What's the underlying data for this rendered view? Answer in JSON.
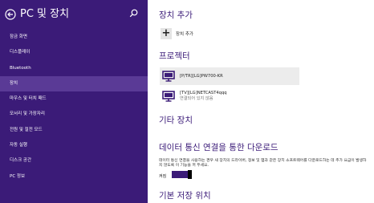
{
  "sidebar": {
    "title": "PC 및 장치",
    "items": [
      {
        "label": "잠금 화면",
        "active": false
      },
      {
        "label": "디스플레이",
        "active": false
      },
      {
        "label": "Bluetooth",
        "active": false
      },
      {
        "label": "장치",
        "active": true
      },
      {
        "label": "마우스 및 터치 패드",
        "active": false
      },
      {
        "label": "모서리 및 가장자리",
        "active": false
      },
      {
        "label": "전원 및 절전 모드",
        "active": false
      },
      {
        "label": "자동 실행",
        "active": false
      },
      {
        "label": "디스크 공간",
        "active": false
      },
      {
        "label": "PC 정보",
        "active": false
      }
    ]
  },
  "main": {
    "add_devices": {
      "heading": "장치 추가",
      "button_label": "장치 추가"
    },
    "projectors": {
      "heading": "프로젝터",
      "devices": [
        {
          "name": "[P/TR][LG]PW700-KR",
          "status": ""
        },
        {
          "name": "[TV][LG]NETCAST4qqq",
          "status": "연결되어 있지 않음"
        }
      ]
    },
    "other_devices": {
      "heading": "기타 장치"
    },
    "metered": {
      "heading": "데이터 통신 연결을 통한 다운로드",
      "description": "데이터 통신 연결을 사용하는 경우 새 장치의 드라이버, 정보 및 앱과 같은 장치 소프트웨어를 다운로드하는 데 추가 요금이 발생하지 않도록 이 기능을 꺼 두세요.",
      "toggle_label": "켜짐",
      "toggle_on": true
    },
    "default_save": {
      "heading": "기본 저장 위치"
    }
  },
  "colors": {
    "accent": "#3b1b78",
    "sidebar_active": "#5a3a96",
    "device_selected_bg": "#ececec"
  }
}
